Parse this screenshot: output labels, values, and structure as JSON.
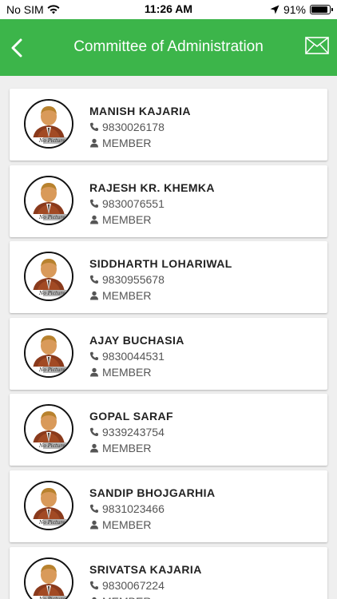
{
  "status_bar": {
    "carrier": "No SIM",
    "time": "11:26 AM",
    "battery": "91%",
    "battery_level": 0.91
  },
  "header": {
    "title": "Committee of Administration",
    "back_icon": "chevron-left-icon",
    "mail_icon": "mail-icon",
    "bg_color": "#3cb54a"
  },
  "avatar_caption": "No Picture",
  "members": [
    {
      "name": "MANISH KAJARIA",
      "phone": "9830026178",
      "role": "MEMBER"
    },
    {
      "name": "RAJESH KR. KHEMKA",
      "phone": "9830076551",
      "role": "MEMBER"
    },
    {
      "name": "SIDDHARTH LOHARIWAL",
      "phone": "9830955678",
      "role": "MEMBER"
    },
    {
      "name": "AJAY BUCHASIA",
      "phone": "9830044531",
      "role": "MEMBER"
    },
    {
      "name": "GOPAL SARAF",
      "phone": "9339243754",
      "role": "MEMBER"
    },
    {
      "name": "SANDIP BHOJGARHIA",
      "phone": "9831023466",
      "role": "MEMBER"
    },
    {
      "name": "SRIVATSA KAJARIA",
      "phone": "9830067224",
      "role": "MEMBER"
    }
  ]
}
